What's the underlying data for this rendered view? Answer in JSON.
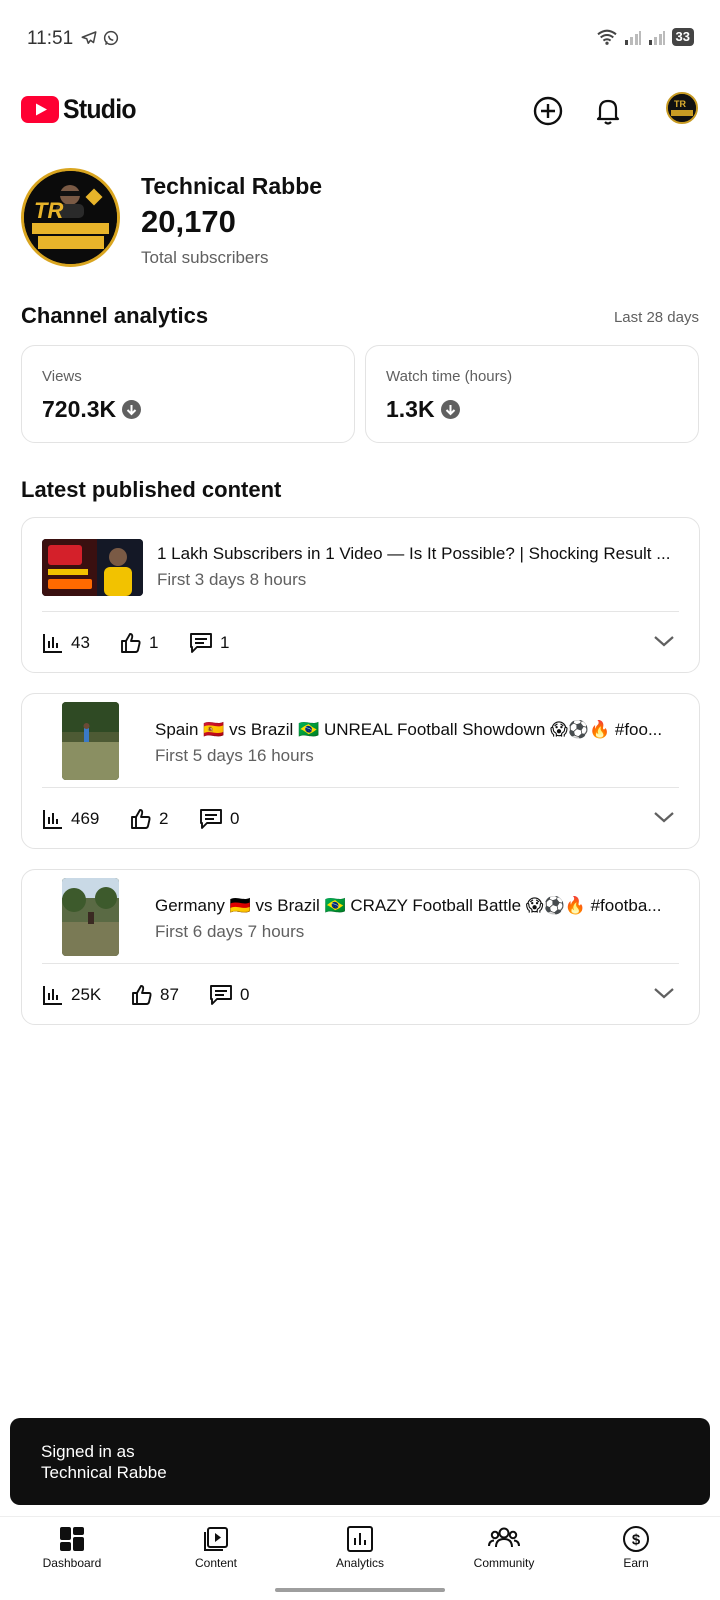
{
  "status_bar": {
    "time": "11:51",
    "battery": "33"
  },
  "header": {
    "app_name": "Studio"
  },
  "channel": {
    "name": "Technical Rabbe",
    "subscribers": "20,170",
    "subscribers_label": "Total subscribers"
  },
  "analytics": {
    "title": "Channel analytics",
    "range": "Last 28 days",
    "views_label": "Views",
    "views_value": "720.3K",
    "watch_label": "Watch time (hours)",
    "watch_value": "1.3K"
  },
  "latest": {
    "title": "Latest published content",
    "items": [
      {
        "title": "1 Lakh Subscribers in 1 Video — Is It Possible? | Shocking Result ...",
        "meta": "First 3 days 8 hours",
        "views": "43",
        "likes": "1",
        "comments": "1"
      },
      {
        "title": "Spain 🇪🇸 vs Brazil 🇧🇷 UNREAL Football Showdown 😱⚽🔥 #foo...",
        "meta": "First 5 days 16 hours",
        "views": "469",
        "likes": "2",
        "comments": "0"
      },
      {
        "title": "Germany 🇩🇪 vs Brazil 🇧🇷 CRAZY Football Battle 😱⚽🔥 #footba...",
        "meta": "First 6 days 7 hours",
        "views": "25K",
        "likes": "87",
        "comments": "0"
      }
    ]
  },
  "toast": {
    "line1": "Signed in as",
    "line2": "Technical Rabbe"
  },
  "nav": {
    "dashboard": "Dashboard",
    "content": "Content",
    "analytics": "Analytics",
    "community": "Community",
    "earn": "Earn"
  }
}
